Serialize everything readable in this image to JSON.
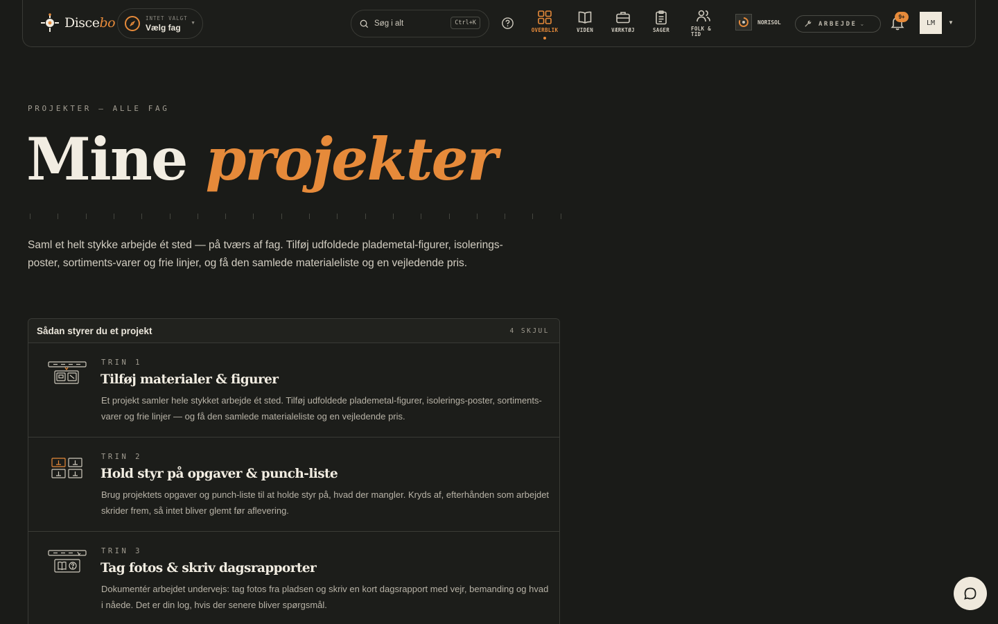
{
  "brand": {
    "name_plain": "Disce",
    "name_accent": "bo"
  },
  "fag_select": {
    "top_label": "INTET VALGT",
    "value": "Vælg fag"
  },
  "search": {
    "placeholder": "Søg i alt",
    "shortcut": "Ctrl+K"
  },
  "nav": [
    {
      "label": "OVERBLIK",
      "icon": "grid-icon",
      "active": true
    },
    {
      "label": "VIDEN",
      "icon": "book-icon",
      "active": false
    },
    {
      "label": "VÆRKTØJ",
      "icon": "toolbox-icon",
      "active": false
    },
    {
      "label": "SAGER",
      "icon": "clipboard-icon",
      "active": false
    },
    {
      "label": "FOLK & TID",
      "icon": "people-icon",
      "active": false
    }
  ],
  "org": {
    "name": "NORISOL"
  },
  "mode": {
    "label": "ARBEJDE"
  },
  "notifications": {
    "badge": "9+"
  },
  "user": {
    "initials": "LM"
  },
  "hero": {
    "eyebrow": "PROJEKTER — ALLE FAG",
    "title_plain": "Mine",
    "title_accent": "projekter",
    "lead": "Saml et helt stykke arbejde ét sted — på tværs af fag. Tilføj udfoldede plademetal-figurer, isolerings-poster, sortiments-varer og frie linjer, og få den samlede materialeliste og en vejledende pris."
  },
  "guide": {
    "title": "Sådan styrer du et projekt",
    "toggle": "4 SKJUL",
    "steps": [
      {
        "num": "TRIN 1",
        "title": "Tilføj materialer & figurer",
        "body": "Et projekt samler hele stykket arbejde ét sted. Tilføj udfoldede plademetal-figurer, isolerings-poster, sortiments-varer og frie linjer — og få den samlede materialeliste og en vejledende pris."
      },
      {
        "num": "TRIN 2",
        "title": "Hold styr på opgaver & punch-liste",
        "body": "Brug projektets opgaver og punch-liste til at holde styr på, hvad der mangler. Kryds af, efterhånden som arbejdet skrider frem, så intet bliver glemt før aflevering."
      },
      {
        "num": "TRIN 3",
        "title": "Tag fotos & skriv dagsrapporter",
        "body": "Dokumentér arbejdet undervejs: tag fotos fra pladsen og skriv en kort dagsrapport med vejr, bemanding og hvad i nåede. Det er din log, hvis der senere bliver spørgsmål."
      }
    ]
  },
  "colors": {
    "accent": "#e68a3a",
    "background": "#1a1b18",
    "text": "#f2ede2"
  }
}
